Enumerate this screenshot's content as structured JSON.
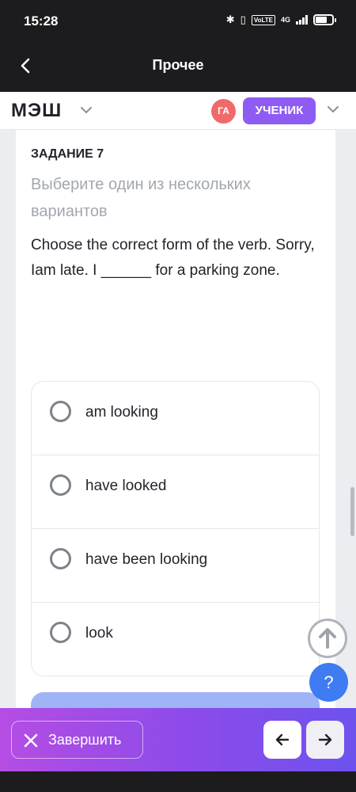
{
  "status_bar": {
    "time": "15:28",
    "network": "4G",
    "volte": "VoLTE"
  },
  "nav_bar": {
    "back_icon": "chevron-left-icon",
    "title": "Прочее"
  },
  "header": {
    "logo": "МЭШ",
    "avatar_initials": "ГА",
    "role": "УЧЕНИК",
    "accent_color": "#8e5cf2",
    "avatar_color": "#f06a6a"
  },
  "task": {
    "number": "ЗАДАНИЕ 7",
    "instruction": "Выберите один из нескольких вариантов",
    "question": "Choose the correct form of the verb. Sorry, Iam late. I ______ for a parking zone.",
    "options": [
      {
        "label": "am looking",
        "selected": false
      },
      {
        "label": "have looked",
        "selected": false
      },
      {
        "label": "have been looking",
        "selected": false
      },
      {
        "label": "look",
        "selected": false
      }
    ]
  },
  "floating": {
    "up_icon": "arrow-up-circle-icon",
    "help_label": "?"
  },
  "bottom_bar": {
    "finish_icon": "close-icon",
    "finish_label": "Завершить",
    "prev_icon": "arrow-left-icon",
    "next_icon": "arrow-right-icon",
    "gradient_start": "#b54de3",
    "gradient_end": "#6e52ee"
  }
}
